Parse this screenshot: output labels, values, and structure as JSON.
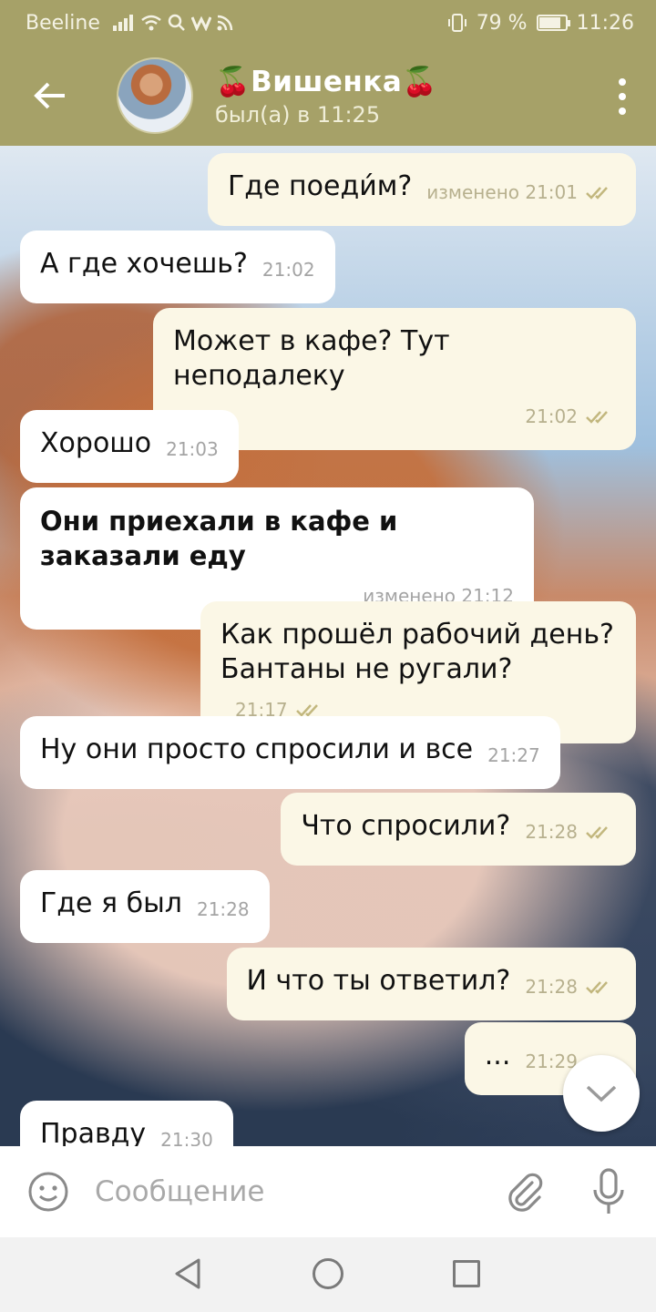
{
  "status_bar": {
    "carrier": "Beeline",
    "battery_text": "79 %",
    "battery_level": 0.79,
    "time": "11:26"
  },
  "header": {
    "chat_name": "🍒Вишенка🍒",
    "last_seen": "был(а) в 11:25"
  },
  "messages": [
    {
      "text": "Где поеди́м?",
      "meta": "изменено 21:01",
      "dir": "out"
    },
    {
      "text": "А где хочешь?",
      "meta": "21:02",
      "dir": "in"
    },
    {
      "text": "Может в кафе? Тут неподалеку",
      "meta": "21:02",
      "dir": "out"
    },
    {
      "text": "Хорошо",
      "meta": "21:03",
      "dir": "in"
    },
    {
      "text": "Они приехали в кафе и заказали еду",
      "meta": "изменено 21:12",
      "dir": "in"
    },
    {
      "text": "Как прошёл рабочий день? Бантаны не ругали?",
      "meta": "21:17",
      "dir": "out"
    },
    {
      "text": "Ну они просто спросили и все",
      "meta": "21:27",
      "dir": "in"
    },
    {
      "text": "Что спросили?",
      "meta": "21:28",
      "dir": "out"
    },
    {
      "text": "Где я был",
      "meta": "21:28",
      "dir": "in"
    },
    {
      "text": "И что ты ответил?",
      "meta": "21:28",
      "dir": "out"
    },
    {
      "text": "...",
      "meta": "21:29",
      "dir": "out"
    },
    {
      "text": "Правду",
      "meta": "21:30",
      "dir": "in"
    }
  ],
  "input": {
    "placeholder": "Сообщение"
  },
  "icons": {
    "back": "arrow-left-icon",
    "menu": "more-vertical-icon",
    "emoji": "smiley-icon",
    "attach": "paperclip-icon",
    "mic": "microphone-icon",
    "scroll": "chevron-down-icon",
    "read": "double-check-icon"
  },
  "colors": {
    "header": "#a6a168",
    "incoming_bubble": "#ffffff",
    "outgoing_bubble": "#fbf7e6",
    "check": "#b7b08e"
  }
}
